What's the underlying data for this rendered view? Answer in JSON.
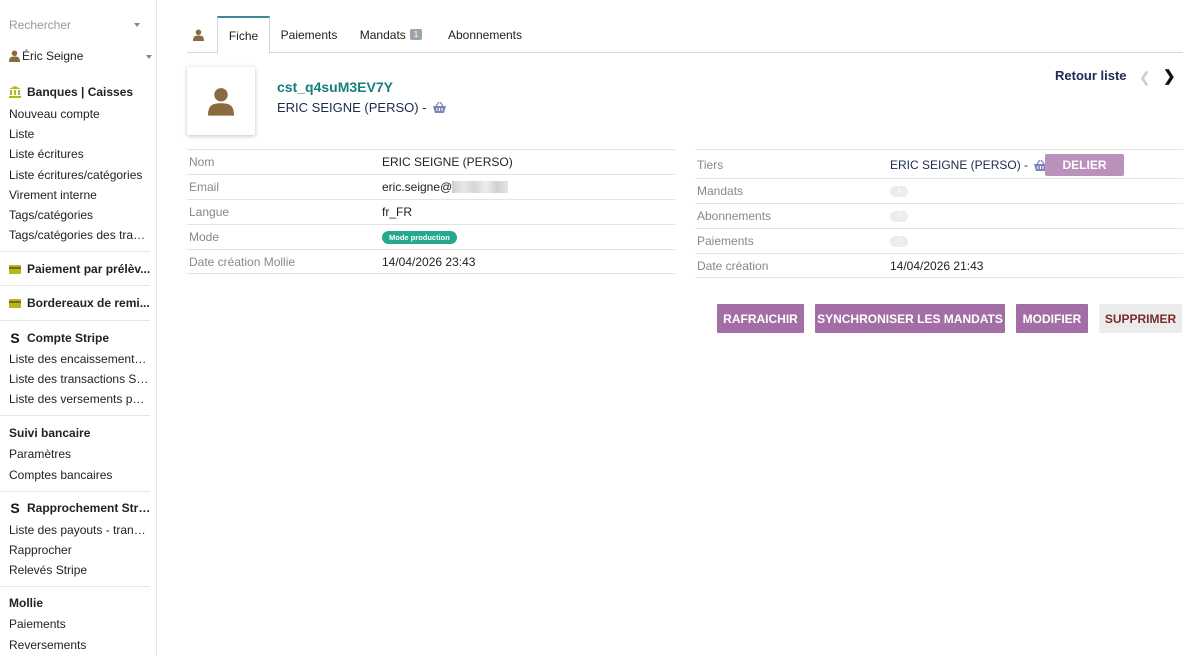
{
  "sidebar": {
    "search_placeholder": "Rechercher",
    "user_name": "Éric Seigne",
    "sections": [
      {
        "title": "Banques | Caisses",
        "items": [
          "Nouveau compte",
          "Liste",
          "Liste écritures",
          "Liste écritures/catégories",
          "Virement interne",
          "Tags/catégories",
          "Tags/catégories des tran..."
        ]
      },
      {
        "title": "Paiement par prélèv...",
        "items": []
      },
      {
        "title": "Bordereaux de remi...",
        "items": []
      },
      {
        "title": "Compte Stripe",
        "items": [
          "Liste des encaissements ...",
          "Liste des transactions Str...",
          "Liste des versements par..."
        ]
      },
      {
        "title": "Suivi bancaire",
        "items": [
          "Paramètres",
          "Comptes bancaires"
        ]
      },
      {
        "title": "Rapprochement Stripe",
        "items": [
          "Liste des payouts - transf...",
          "Rapprocher",
          "Relevés Stripe"
        ]
      },
      {
        "title": "Mollie",
        "items": [
          "Paiements",
          "Reversements"
        ]
      }
    ]
  },
  "tabs": [
    {
      "label": "Fiche"
    },
    {
      "label": "Paiements"
    },
    {
      "label": "Mandats",
      "badge": "1"
    },
    {
      "label": "Abonnements"
    }
  ],
  "header": {
    "ref": "cst_q4suM3EV7Y",
    "name": "ERIC SEIGNE (PERSO) -",
    "retour": "Retour liste"
  },
  "left_fields": [
    {
      "label": "Nom",
      "value": "ERIC SEIGNE (PERSO)"
    },
    {
      "label": "Email",
      "value": "eric.seigne@"
    },
    {
      "label": "Langue",
      "value": "fr_FR"
    },
    {
      "label": "Mode",
      "value": "Mode production"
    },
    {
      "label": "Date création Mollie",
      "value": "14/04/2026 23:43"
    }
  ],
  "right_fields": [
    {
      "label": "Tiers",
      "value": "ERIC SEIGNE (PERSO) -"
    },
    {
      "label": "Mandats",
      "value": "1"
    },
    {
      "label": "Abonnements",
      "value": "0"
    },
    {
      "label": "Paiements",
      "value": "0"
    },
    {
      "label": "Date création",
      "value": "14/04/2026 21:43"
    }
  ],
  "buttons": {
    "delier": "DELIER",
    "rafraichir": "RAFRAICHIR",
    "synchroniser": "SYNCHRONISER LES MANDATS",
    "modifier": "MODIFIER",
    "supprimer": "SUPPRIMER"
  },
  "colors": {
    "accent": "#a36ea5",
    "link": "#177e7f",
    "mode_pill": "#25a88d"
  }
}
